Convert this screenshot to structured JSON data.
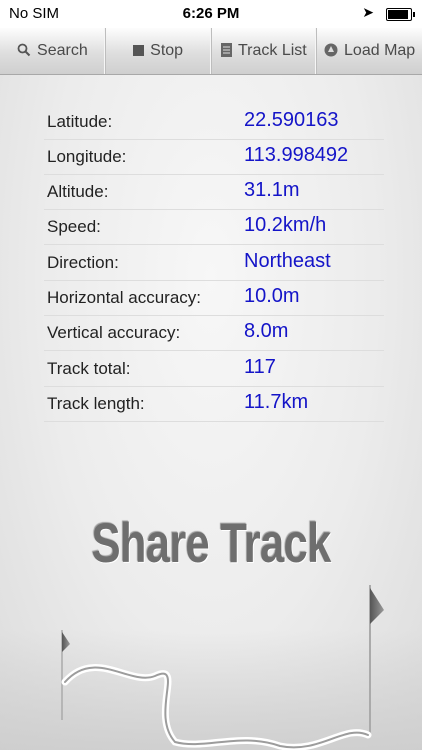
{
  "status_bar": {
    "carrier": "No SIM",
    "time": "6:26 PM",
    "location_icon": "location-arrow-icon",
    "battery_level": 0.95
  },
  "toolbar": {
    "items": [
      {
        "label": "Search",
        "icon": "search-icon"
      },
      {
        "label": "Stop",
        "icon": "stop-icon"
      },
      {
        "label": "Track List",
        "icon": "list-icon"
      },
      {
        "label": "Load Map",
        "icon": "map-icon"
      }
    ]
  },
  "info": {
    "rows": [
      {
        "label": "Latitude:",
        "value": "22.590163"
      },
      {
        "label": "Longitude:",
        "value": "113.998492"
      },
      {
        "label": "Altitude:",
        "value": "31.1m"
      },
      {
        "label": "Speed:",
        "value": "10.2km/h"
      },
      {
        "label": "Direction:",
        "value": "Northeast"
      },
      {
        "label": "Horizontal accuracy:",
        "value": "10.0m"
      },
      {
        "label": "Vertical accuracy:",
        "value": "8.0m"
      },
      {
        "label": "Track total:",
        "value": "117"
      },
      {
        "label": "Track length:",
        "value": "11.7km"
      }
    ]
  },
  "share": {
    "title": "Share Track"
  },
  "colors": {
    "value_text": "#1414c8",
    "label_text": "#222222",
    "toolbar_text": "#4a4a4a"
  }
}
